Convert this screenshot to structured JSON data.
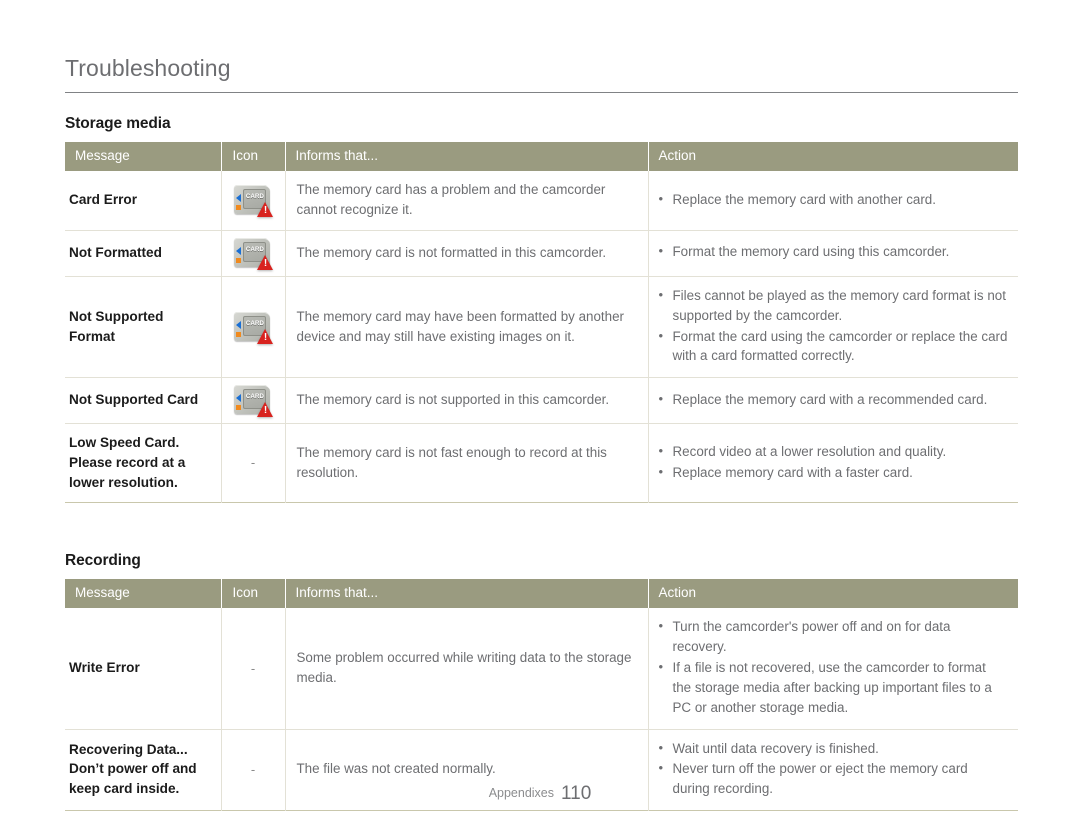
{
  "document": {
    "chapter_title": "Troubleshooting",
    "footer_label": "Appendixes",
    "page_number": "110"
  },
  "colors": {
    "header_bar": "#9a9b80",
    "header_text": "#ffffff",
    "body_text": "#6d6e71",
    "message_text": "#1b1b1b",
    "row_divider": "#e3e1d6",
    "table_bottom_border": "#c9c7ac",
    "warning_red": "#d8231f",
    "card_blue": "#1a6fd4",
    "card_orange": "#f08a1e"
  },
  "columns": {
    "message": "Message",
    "icon": "Icon",
    "informs": "Informs that...",
    "action": "Action"
  },
  "sections": [
    {
      "heading": "Storage media",
      "rows": [
        {
          "message": "Card Error",
          "icon": "card-warning-icon",
          "icon_label": "CARD",
          "informs": "The memory card has a problem and the camcorder cannot recognize it.",
          "actions": [
            "Replace the memory card with another card."
          ]
        },
        {
          "message": "Not Formatted",
          "icon": "card-warning-icon",
          "icon_label": "CARD",
          "informs": "The memory card is not formatted in this camcorder.",
          "actions": [
            "Format the memory card using this camcorder."
          ]
        },
        {
          "message": "Not Supported Format",
          "icon": "card-warning-icon",
          "icon_label": "CARD",
          "informs": "The memory card may have been formatted by another device and may still have existing images on it.",
          "actions": [
            "Files cannot be played as the memory card format is not supported by the camcorder.",
            "Format the card using the camcorder or replace the card with a card formatted correctly."
          ]
        },
        {
          "message": "Not Supported Card",
          "icon": "card-warning-icon",
          "icon_label": "CARD",
          "informs": "The memory card is not supported in this camcorder.",
          "actions": [
            "Replace the memory card with a recommended card."
          ]
        },
        {
          "message": "Low Speed Card. Please record at a lower resolution.",
          "icon": "none",
          "icon_label": "-",
          "informs": "The memory card is not fast enough to record at this resolution.",
          "actions": [
            "Record video at a lower resolution and quality.",
            "Replace memory card with a faster card."
          ]
        }
      ]
    },
    {
      "heading": "Recording",
      "rows": [
        {
          "message": "Write Error",
          "icon": "none",
          "icon_label": "-",
          "informs": "Some problem occurred while writing data to the storage media.",
          "actions": [
            "Turn the camcorder's power off and on for data recovery.",
            "If a file is not recovered, use the camcorder to format the storage media after backing up important files to a PC or another storage media."
          ]
        },
        {
          "message": "Recovering Data... Don’t power off and keep card inside.",
          "icon": "none",
          "icon_label": "-",
          "informs": "The file was not created normally.",
          "actions": [
            "Wait until data recovery is finished.",
            "Never turn off the power or eject the memory card during recording."
          ]
        }
      ]
    }
  ]
}
